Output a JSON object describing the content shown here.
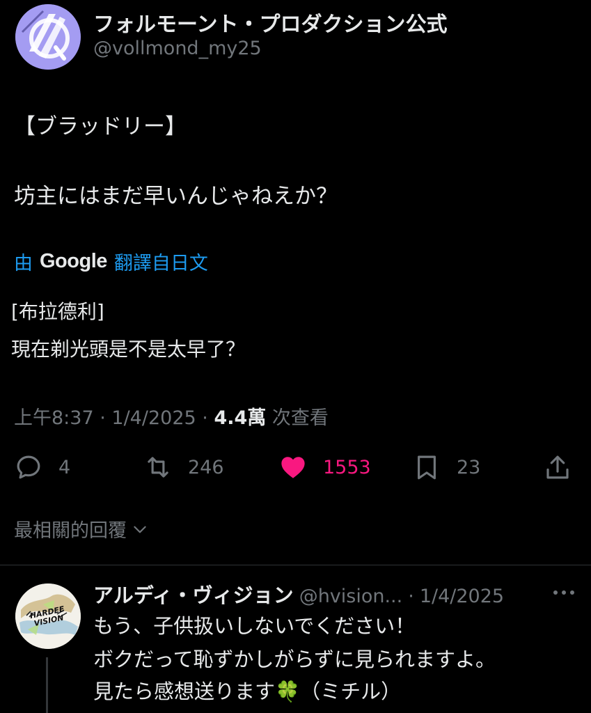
{
  "post": {
    "display_name": "フォルモーント・プロダクション公式",
    "handle": "@vollmond_my25",
    "text_lines": [
      "【ブラッドリー】",
      "坊主にはまだ早いんじゃねえか？"
    ],
    "translation": {
      "prefix": "由",
      "provider": "Google",
      "suffix": "翻譯自日文",
      "lines": [
        "[布拉德利]",
        "現在剃光頭是不是太早了？"
      ]
    },
    "meta": {
      "time": "上午8:37",
      "date": "1/4/2025",
      "views": "4.4萬",
      "views_label": "次查看"
    },
    "actions": {
      "reply_count": "4",
      "retweet_count": "246",
      "like_count": "1553",
      "bookmark_count": "23"
    },
    "colors": {
      "like": "#f91880",
      "link": "#1d9bf0",
      "muted": "#71767b"
    }
  },
  "replies_filter": {
    "label": "最相關的回覆"
  },
  "reply": {
    "display_name": "アルディ・ヴィジョン",
    "handle": "@hvision...",
    "separator": "·",
    "date": "1/4/2025",
    "avatar_text": "HARDEE VISION",
    "lines": [
      "もう、子供扱いしないでください！",
      "ボクだって恥ずかしがらずに見られますよ。",
      "見たら感想送ります🍀（ミチル）"
    ]
  },
  "icons": [
    "reply-icon",
    "retweet-icon",
    "like-icon",
    "bookmark-icon",
    "share-icon",
    "chevron-down-icon",
    "more-icon"
  ]
}
